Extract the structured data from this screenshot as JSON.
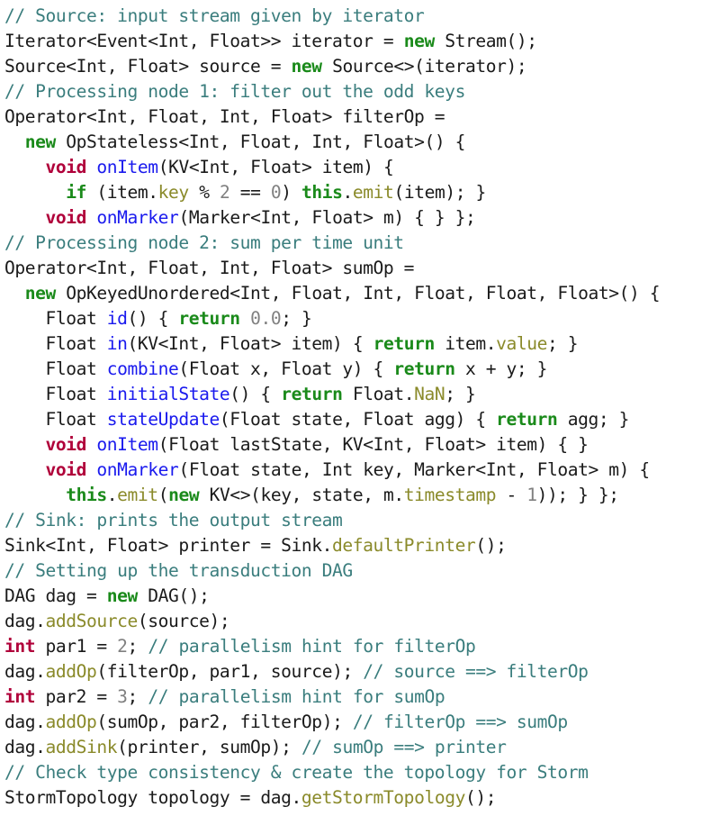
{
  "editor": {
    "language": "java",
    "background_color": "#ffffff",
    "default_text_color": "#1a1a1a"
  },
  "syntax_colors": {
    "plain": "#1a1a1a",
    "comment": "#3a7d7d",
    "keyword": "#1a8a1a",
    "type_keyword": "#b0003a",
    "method_name": "#1a1aee",
    "member_access": "#8a8a2a",
    "number": "#808080"
  },
  "code": {
    "line_count": 32,
    "lines": [
      [
        {
          "t": "comment",
          "s": "// Source: input stream given by iterator"
        }
      ],
      [
        {
          "t": "plain",
          "s": "Iterator<Event<Int, Float>> iterator = "
        },
        {
          "t": "keyword",
          "s": "new"
        },
        {
          "t": "plain",
          "s": " Stream();"
        }
      ],
      [
        {
          "t": "plain",
          "s": "Source<Int, Float> source = "
        },
        {
          "t": "keyword",
          "s": "new"
        },
        {
          "t": "plain",
          "s": " Source<>(iterator);"
        }
      ],
      [
        {
          "t": "comment",
          "s": "// Processing node 1: filter out the odd keys"
        }
      ],
      [
        {
          "t": "plain",
          "s": "Operator<Int, Float, Int, Float> filterOp ="
        }
      ],
      [
        {
          "t": "plain",
          "s": "  "
        },
        {
          "t": "keyword",
          "s": "new"
        },
        {
          "t": "plain",
          "s": " OpStateless<Int, Float, Int, Float>() {"
        }
      ],
      [
        {
          "t": "plain",
          "s": "    "
        },
        {
          "t": "type",
          "s": "void"
        },
        {
          "t": "plain",
          "s": " "
        },
        {
          "t": "method",
          "s": "onItem"
        },
        {
          "t": "plain",
          "s": "(KV<Int, Float> item) {"
        }
      ],
      [
        {
          "t": "plain",
          "s": "      "
        },
        {
          "t": "keyword",
          "s": "if"
        },
        {
          "t": "plain",
          "s": " (item."
        },
        {
          "t": "member",
          "s": "key"
        },
        {
          "t": "plain",
          "s": " % "
        },
        {
          "t": "number",
          "s": "2"
        },
        {
          "t": "plain",
          "s": " == "
        },
        {
          "t": "number",
          "s": "0"
        },
        {
          "t": "plain",
          "s": ") "
        },
        {
          "t": "keyword",
          "s": "this"
        },
        {
          "t": "plain",
          "s": "."
        },
        {
          "t": "member",
          "s": "emit"
        },
        {
          "t": "plain",
          "s": "(item); }"
        }
      ],
      [
        {
          "t": "plain",
          "s": "    "
        },
        {
          "t": "type",
          "s": "void"
        },
        {
          "t": "plain",
          "s": " "
        },
        {
          "t": "method",
          "s": "onMarker"
        },
        {
          "t": "plain",
          "s": "(Marker<Int, Float> m) { } };"
        }
      ],
      [
        {
          "t": "comment",
          "s": "// Processing node 2: sum per time unit"
        }
      ],
      [
        {
          "t": "plain",
          "s": "Operator<Int, Float, Int, Float> sumOp ="
        }
      ],
      [
        {
          "t": "plain",
          "s": "  "
        },
        {
          "t": "keyword",
          "s": "new"
        },
        {
          "t": "plain",
          "s": " OpKeyedUnordered<Int, Float, Int, Float, Float, Float>() {"
        }
      ],
      [
        {
          "t": "plain",
          "s": "    Float "
        },
        {
          "t": "method",
          "s": "id"
        },
        {
          "t": "plain",
          "s": "() { "
        },
        {
          "t": "keyword",
          "s": "return"
        },
        {
          "t": "plain",
          "s": " "
        },
        {
          "t": "number",
          "s": "0.0"
        },
        {
          "t": "plain",
          "s": "; }"
        }
      ],
      [
        {
          "t": "plain",
          "s": "    Float "
        },
        {
          "t": "method",
          "s": "in"
        },
        {
          "t": "plain",
          "s": "(KV<Int, Float> item) { "
        },
        {
          "t": "keyword",
          "s": "return"
        },
        {
          "t": "plain",
          "s": " item."
        },
        {
          "t": "member",
          "s": "value"
        },
        {
          "t": "plain",
          "s": "; }"
        }
      ],
      [
        {
          "t": "plain",
          "s": "    Float "
        },
        {
          "t": "method",
          "s": "combine"
        },
        {
          "t": "plain",
          "s": "(Float x, Float y) { "
        },
        {
          "t": "keyword",
          "s": "return"
        },
        {
          "t": "plain",
          "s": " x + y; }"
        }
      ],
      [
        {
          "t": "plain",
          "s": "    Float "
        },
        {
          "t": "method",
          "s": "initialState"
        },
        {
          "t": "plain",
          "s": "() { "
        },
        {
          "t": "keyword",
          "s": "return"
        },
        {
          "t": "plain",
          "s": " Float."
        },
        {
          "t": "member",
          "s": "NaN"
        },
        {
          "t": "plain",
          "s": "; }"
        }
      ],
      [
        {
          "t": "plain",
          "s": "    Float "
        },
        {
          "t": "method",
          "s": "stateUpdate"
        },
        {
          "t": "plain",
          "s": "(Float state, Float agg) { "
        },
        {
          "t": "keyword",
          "s": "return"
        },
        {
          "t": "plain",
          "s": " agg; }"
        }
      ],
      [
        {
          "t": "plain",
          "s": "    "
        },
        {
          "t": "type",
          "s": "void"
        },
        {
          "t": "plain",
          "s": " "
        },
        {
          "t": "method",
          "s": "onItem"
        },
        {
          "t": "plain",
          "s": "(Float lastState, KV<Int, Float> item) { }"
        }
      ],
      [
        {
          "t": "plain",
          "s": "    "
        },
        {
          "t": "type",
          "s": "void"
        },
        {
          "t": "plain",
          "s": " "
        },
        {
          "t": "method",
          "s": "onMarker"
        },
        {
          "t": "plain",
          "s": "(Float state, Int key, Marker<Int, Float> m) {"
        }
      ],
      [
        {
          "t": "plain",
          "s": "      "
        },
        {
          "t": "keyword",
          "s": "this"
        },
        {
          "t": "plain",
          "s": "."
        },
        {
          "t": "member",
          "s": "emit"
        },
        {
          "t": "plain",
          "s": "("
        },
        {
          "t": "keyword",
          "s": "new"
        },
        {
          "t": "plain",
          "s": " KV<>(key, state, m."
        },
        {
          "t": "member",
          "s": "timestamp"
        },
        {
          "t": "plain",
          "s": " - "
        },
        {
          "t": "number",
          "s": "1"
        },
        {
          "t": "plain",
          "s": ")); } };"
        }
      ],
      [
        {
          "t": "comment",
          "s": "// Sink: prints the output stream"
        }
      ],
      [
        {
          "t": "plain",
          "s": "Sink<Int, Float> printer = Sink."
        },
        {
          "t": "member",
          "s": "defaultPrinter"
        },
        {
          "t": "plain",
          "s": "();"
        }
      ],
      [
        {
          "t": "comment",
          "s": "// Setting up the transduction DAG"
        }
      ],
      [
        {
          "t": "plain",
          "s": "DAG dag = "
        },
        {
          "t": "keyword",
          "s": "new"
        },
        {
          "t": "plain",
          "s": " DAG();"
        }
      ],
      [
        {
          "t": "plain",
          "s": "dag."
        },
        {
          "t": "member",
          "s": "addSource"
        },
        {
          "t": "plain",
          "s": "(source);"
        }
      ],
      [
        {
          "t": "type",
          "s": "int"
        },
        {
          "t": "plain",
          "s": " par1 = "
        },
        {
          "t": "number",
          "s": "2"
        },
        {
          "t": "plain",
          "s": "; "
        },
        {
          "t": "comment",
          "s": "// parallelism hint for filterOp"
        }
      ],
      [
        {
          "t": "plain",
          "s": "dag."
        },
        {
          "t": "member",
          "s": "addOp"
        },
        {
          "t": "plain",
          "s": "(filterOp, par1, source); "
        },
        {
          "t": "comment",
          "s": "// source ==> filterOp"
        }
      ],
      [
        {
          "t": "type",
          "s": "int"
        },
        {
          "t": "plain",
          "s": " par2 = "
        },
        {
          "t": "number",
          "s": "3"
        },
        {
          "t": "plain",
          "s": "; "
        },
        {
          "t": "comment",
          "s": "// parallelism hint for sumOp"
        }
      ],
      [
        {
          "t": "plain",
          "s": "dag."
        },
        {
          "t": "member",
          "s": "addOp"
        },
        {
          "t": "plain",
          "s": "(sumOp, par2, filterOp); "
        },
        {
          "t": "comment",
          "s": "// filterOp ==> sumOp"
        }
      ],
      [
        {
          "t": "plain",
          "s": "dag."
        },
        {
          "t": "member",
          "s": "addSink"
        },
        {
          "t": "plain",
          "s": "(printer, sumOp); "
        },
        {
          "t": "comment",
          "s": "// sumOp ==> printer"
        }
      ],
      [
        {
          "t": "comment",
          "s": "// Check type consistency & create the topology for Storm"
        }
      ],
      [
        {
          "t": "plain",
          "s": "StormTopology topology = dag."
        },
        {
          "t": "member",
          "s": "getStormTopology"
        },
        {
          "t": "plain",
          "s": "();"
        }
      ]
    ]
  }
}
